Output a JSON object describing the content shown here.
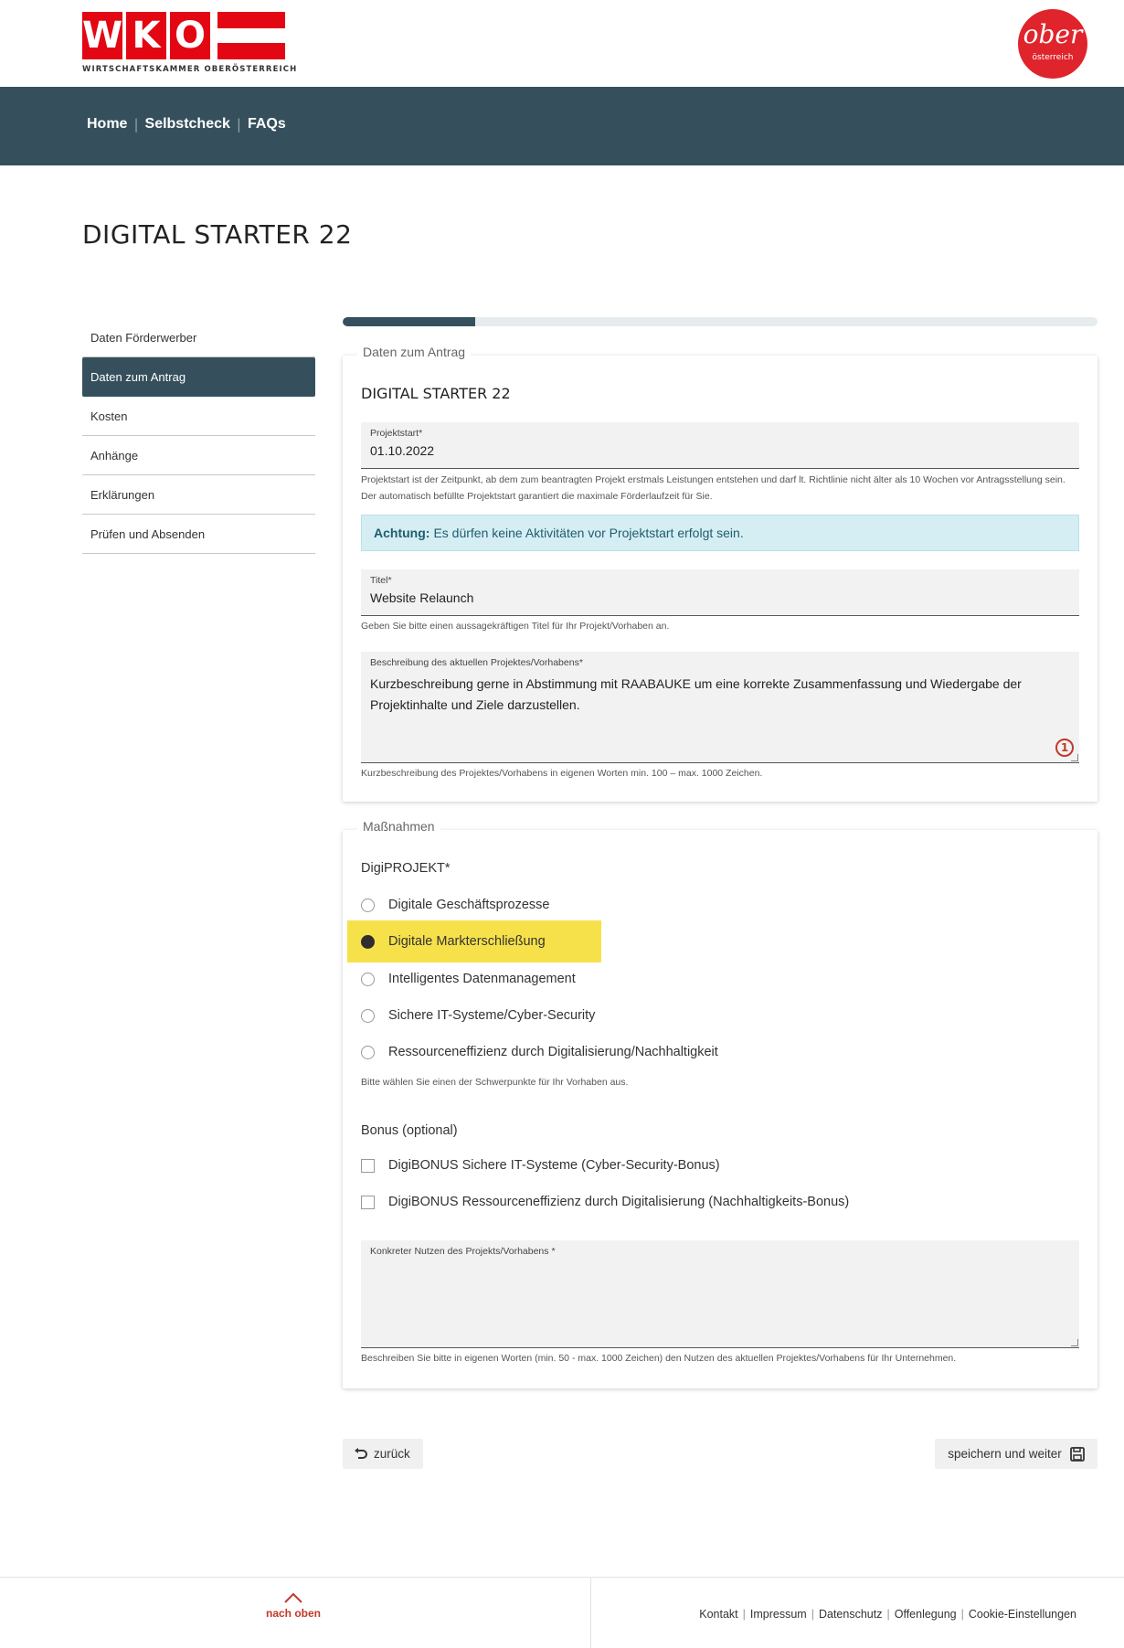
{
  "header": {
    "logo_letters": [
      "W",
      "K",
      "O"
    ],
    "logo_subtitle": "WIRTSCHAFTSKAMMER OBERÖSTERREICH",
    "ober_word": "ober",
    "ober_sub": "österreich"
  },
  "nav": {
    "items": [
      "Home",
      "Selbstcheck",
      "FAQs"
    ]
  },
  "page_title": "DIGITAL STARTER 22",
  "sidebar": {
    "items": [
      {
        "label": "Daten Förderwerber",
        "active": false
      },
      {
        "label": "Daten zum Antrag",
        "active": true
      },
      {
        "label": "Kosten",
        "active": false
      },
      {
        "label": "Anhänge",
        "active": false
      },
      {
        "label": "Erklärungen",
        "active": false
      },
      {
        "label": "Prüfen und Absenden",
        "active": false
      }
    ]
  },
  "progress": {
    "fraction": 0.175
  },
  "antrag": {
    "legend": "Daten zum Antrag",
    "heading": "DIGITAL STARTER 22",
    "projektstart": {
      "label": "Projektstart*",
      "value": "01.10.2022",
      "help": "Projektstart ist der Zeitpunkt, ab dem zum beantragten Projekt erstmals Leistungen entstehen und darf lt. Richtlinie nicht älter als 10 Wochen vor Antragsstellung sein. Der automatisch befüllte Projektstart garantiert die maximale Förderlaufzeit für Sie."
    },
    "alert": {
      "strong": "Achtung:",
      "text": "Es dürfen keine Aktivitäten vor Projektstart erfolgt sein."
    },
    "titel": {
      "label": "Titel*",
      "value": "Website Relaunch",
      "help": "Geben Sie bitte einen aussagekräftigen Titel für Ihr Projekt/Vorhaben an."
    },
    "beschreibung": {
      "label": "Beschreibung des aktuellen Projektes/Vorhabens*",
      "value": "Kurzbeschreibung gerne in Abstimmung mit RAABAUKE um eine korrekte Zusammenfassung und Wiedergabe der Projektinhalte und Ziele darzustellen.",
      "counter": "1",
      "help": "Kurzbeschreibung des Projektes/Vorhabens in eigenen Worten min. 100 – max. 1000 Zeichen."
    }
  },
  "massnahmen": {
    "legend": "Maßnahmen",
    "digiprojekt_title": "DigiPROJEKT*",
    "options": [
      {
        "label": "Digitale Geschäftsprozesse",
        "selected": false
      },
      {
        "label": "Digitale Markterschließung",
        "selected": true
      },
      {
        "label": "Intelligentes Datenmanagement",
        "selected": false
      },
      {
        "label": "Sichere IT-Systeme/Cyber-Security",
        "selected": false
      },
      {
        "label": "Ressourceneffizienz durch Digitalisierung/Nachhaltigkeit",
        "selected": false
      }
    ],
    "options_help": "Bitte wählen Sie einen der Schwerpunkte für Ihr Vorhaben aus.",
    "bonus_title": "Bonus (optional)",
    "bonus_options": [
      {
        "label": "DigiBONUS Sichere IT-Systeme (Cyber-Security-Bonus)",
        "checked": false
      },
      {
        "label": "DigiBONUS Ressourceneffizienz durch Digitalisierung (Nachhaltigkeits-Bonus)",
        "checked": false
      }
    ],
    "nutzen": {
      "label": "Konkreter Nutzen des Projekts/Vorhabens *",
      "value": "",
      "help": "Beschreiben Sie bitte in eigenen Worten (min. 50 - max. 1000 Zeichen) den Nutzen des aktuellen Projektes/Vorhabens für Ihr Unternehmen."
    }
  },
  "buttons": {
    "back": "zurück",
    "save": "speichern und weiter"
  },
  "footer": {
    "to_top": "nach oben",
    "links": [
      "Kontakt",
      "Impressum",
      "Datenschutz",
      "Offenlegung",
      "Cookie-Einstellungen"
    ]
  },
  "colors": {
    "nav_bg": "#35505c",
    "brand_red": "#e30613",
    "highlight": "#f6e14a",
    "alert_bg": "#d5eef3"
  }
}
